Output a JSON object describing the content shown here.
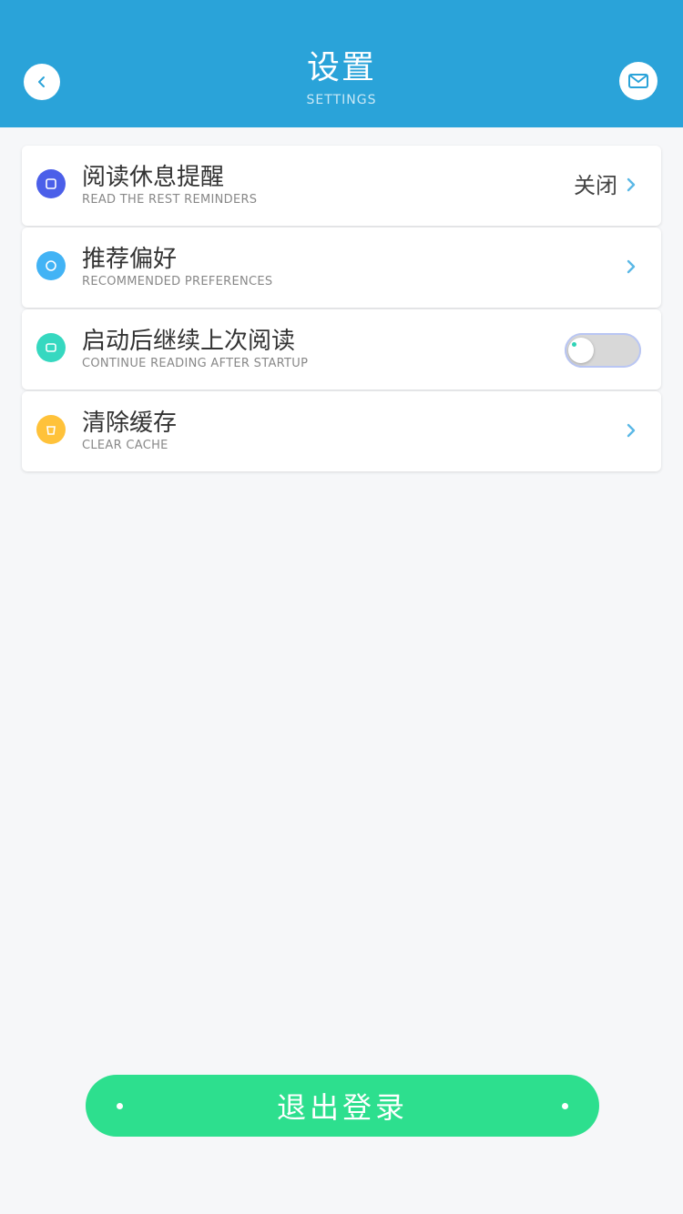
{
  "header": {
    "title": "设置",
    "subtitle": "SETTINGS",
    "back_icon": "chevron-left-icon",
    "message_icon": "mail-icon",
    "color": "#2aa3d9"
  },
  "settings": {
    "items": [
      {
        "label": "阅读休息提醒",
        "sub_label": "READ THE REST REMINDERS",
        "value": "关闭",
        "icon": "reminder-icon",
        "icon_color": "#4b5fe9"
      },
      {
        "label": "推荐偏好",
        "sub_label": "RECOMMENDED PREFERENCES",
        "icon": "preference-icon",
        "icon_color": "#42b3f5"
      },
      {
        "label": "启动后继续上次阅读",
        "sub_label": "CONTINUE READING AFTER STARTUP",
        "icon": "continue-icon",
        "icon_color": "#36d8c0",
        "toggle_on": false
      },
      {
        "label": "清除缓存",
        "sub_label": "CLEAR CACHE",
        "icon": "cache-icon",
        "icon_color": "#ffc23a"
      }
    ]
  },
  "logout": {
    "label": "退出登录",
    "color": "#2ddf8e"
  }
}
